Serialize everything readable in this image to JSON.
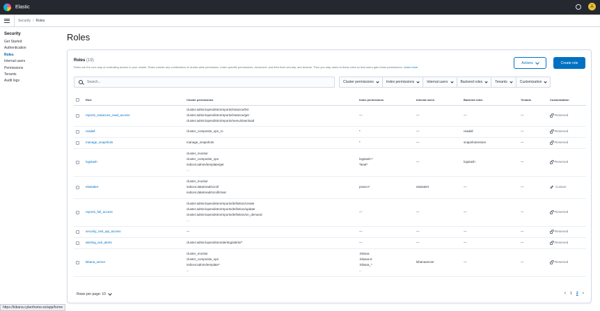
{
  "app": {
    "title": "Elastic",
    "avatar_letter": "A"
  },
  "breadcrumbs": [
    "Security",
    "Roles"
  ],
  "sidebar": {
    "title": "Security",
    "items": [
      {
        "label": "Get Started",
        "active": false
      },
      {
        "label": "Authentication",
        "active": false
      },
      {
        "label": "Roles",
        "active": true
      },
      {
        "label": "Internal users",
        "active": false
      },
      {
        "label": "Permissions",
        "active": false
      },
      {
        "label": "Tenants",
        "active": false
      },
      {
        "label": "Audit logs",
        "active": false
      }
    ]
  },
  "page": {
    "title": "Roles"
  },
  "panel": {
    "heading": "Roles",
    "count": "(19)",
    "description": "Roles are the core way of controlling access to your cluster. Roles contain any combination of cluster-wide permission, index-specific permissions, document- and field-level security, and tenants. Then you map users to these roles so that users gain those permissions.",
    "learn_more": "Learn more",
    "actions_label": "Actions",
    "create_label": "Create role",
    "search_placeholder": "Search...",
    "filters": [
      "Cluster permissions",
      "Index permissions",
      "Internal users",
      "Backend roles",
      "Tenants",
      "Customization"
    ]
  },
  "table": {
    "headers": [
      "Role",
      "Cluster permissions",
      "Index permissions",
      "Internal users",
      "Backend roles",
      "Tenants",
      "Customization"
    ],
    "rows": [
      {
        "role": "reports_instances_read_access",
        "cluster": [
          "cluster:admin/opendistro/reports/instance/list",
          "cluster:admin/opendistro/reports/instance/get",
          "cluster:admin/opendistro/reports/menu/download"
        ],
        "index": [
          "—"
        ],
        "users": [
          "—"
        ],
        "backend": [
          "—"
        ],
        "tenants": "—",
        "custom": "Reserved"
      },
      {
        "role": "readall",
        "cluster": [
          "cluster_composite_ops_ro"
        ],
        "index": [
          "*"
        ],
        "users": [
          "—"
        ],
        "backend": [
          "readall"
        ],
        "tenants": "—",
        "custom": "Reserved"
      },
      {
        "role": "manage_snapshots",
        "cluster": [
          "manage_snapshots"
        ],
        "index": [
          "*"
        ],
        "users": [
          "—"
        ],
        "backend": [
          "snapshotrestore"
        ],
        "tenants": "—",
        "custom": "Reserved"
      },
      {
        "role": "logstash",
        "cluster": [
          "cluster_monitor",
          "cluster_composite_ops",
          "indices:admin/template/get",
          "..."
        ],
        "index": [
          "logstash-*",
          "*beat*"
        ],
        "users": [
          "—"
        ],
        "backend": [
          "logstash"
        ],
        "tenants": "—",
        "custom": "Reserved"
      },
      {
        "role": "elastalert",
        "cluster": [
          "cluster_monitor",
          "indices:data/read/scroll",
          "indices:data/read/scroll/clear"
        ],
        "index": [
          "praeco*"
        ],
        "users": [
          "elastalert"
        ],
        "backend": [
          "—"
        ],
        "tenants": "—",
        "custom": "Custom"
      },
      {
        "role": "reports_full_access",
        "cluster": [
          "cluster:admin/opendistro/reports/definition/create",
          "cluster:admin/opendistro/reports/definition/update",
          "cluster:admin/opendistro/reports/definition/on_demand",
          "..."
        ],
        "index": [
          "—"
        ],
        "users": [
          "—"
        ],
        "backend": [
          "—"
        ],
        "tenants": "—",
        "custom": "Reserved"
      },
      {
        "role": "security_rest_api_access",
        "cluster": [
          "—"
        ],
        "index": [
          "—"
        ],
        "users": [
          "—"
        ],
        "backend": [
          "—"
        ],
        "tenants": "—",
        "custom": "Reserved"
      },
      {
        "role": "alerting_ack_alerts",
        "cluster": [
          "cluster:admin/opendistro/alerting/alerts/*"
        ],
        "index": [
          "—"
        ],
        "users": [
          "—"
        ],
        "backend": [
          "—"
        ],
        "tenants": "—",
        "custom": "Reserved"
      },
      {
        "role": "kibana_server",
        "cluster": [
          "cluster_monitor",
          "cluster_composite_ops",
          "indices:admin/template*",
          "..."
        ],
        "index": [
          ".kibana",
          ".kibana-6",
          ".kibana_*",
          "..."
        ],
        "users": [
          "kibanaserver"
        ],
        "backend": [
          "—"
        ],
        "tenants": "—",
        "custom": "Reserved"
      }
    ]
  },
  "pagination": {
    "rows_label": "Rows per page: 10",
    "pages": [
      "1",
      "2"
    ],
    "active_page": "2"
  },
  "statusbar": {
    "url": "https://kibana.cyberhome.es/app/home"
  }
}
